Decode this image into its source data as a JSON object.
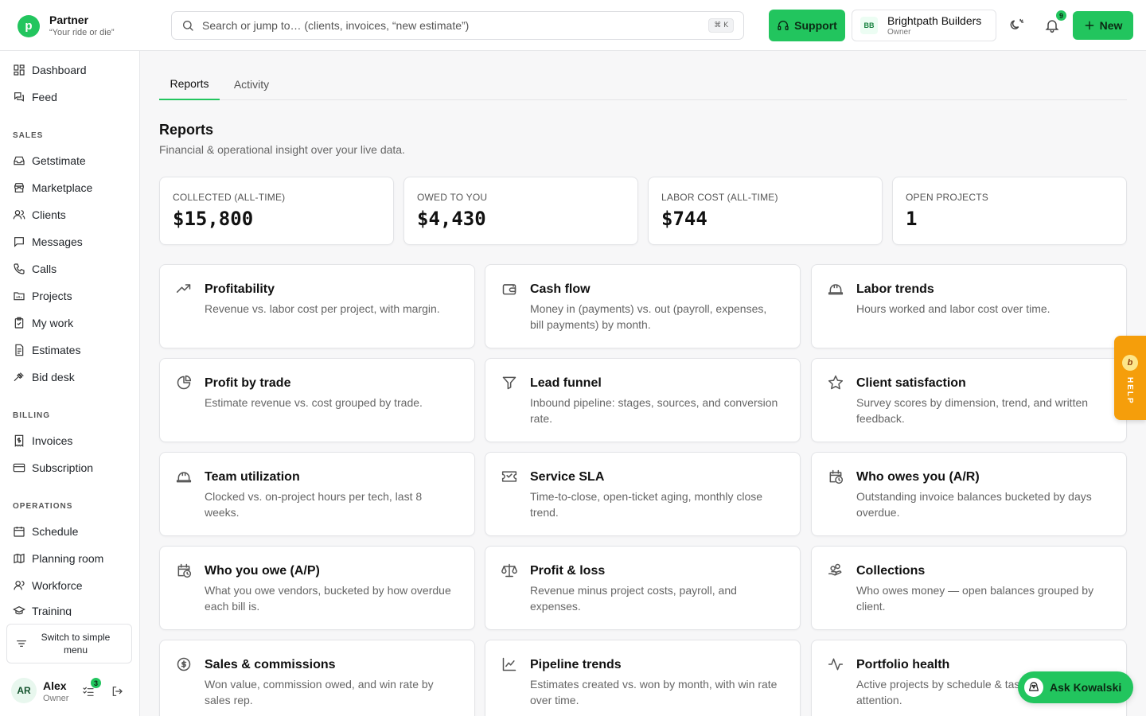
{
  "header": {
    "brand_initial": "p",
    "brand_name": "Partner",
    "brand_tagline": "“Your ride or die”",
    "search_placeholder": "Search or jump to… (clients, invoices, “new estimate”)",
    "search_shortcut": "⌘ K",
    "support_label": "Support",
    "org_initials": "BB",
    "org_name": "Brightpath Builders",
    "org_role": "Owner",
    "notifications_count": "9",
    "new_label": "New"
  },
  "sidebar": {
    "top_items": [
      {
        "label": "Dashboard",
        "icon": "dashboard-icon"
      },
      {
        "label": "Feed",
        "icon": "feed-icon"
      }
    ],
    "sections": [
      {
        "title": "SALES",
        "items": [
          "Getstimate",
          "Marketplace",
          "Clients",
          "Messages",
          "Calls",
          "Projects",
          "My work",
          "Estimates",
          "Bid desk"
        ]
      },
      {
        "title": "BILLING",
        "items": [
          "Invoices",
          "Subscription"
        ]
      },
      {
        "title": "OPERATIONS",
        "items": [
          "Schedule",
          "Planning room",
          "Workforce",
          "Training"
        ]
      }
    ],
    "switch_label": "Switch to simple menu",
    "user_initials": "AR",
    "user_name": "Alex",
    "user_role": "Owner",
    "tasks_count": "3"
  },
  "main": {
    "tabs": [
      "Reports",
      "Activity"
    ],
    "active_tab": "Reports",
    "title": "Reports",
    "subtitle": "Financial & operational insight over your live data.",
    "stats": [
      {
        "label": "COLLECTED (ALL-TIME)",
        "value": "$15,800"
      },
      {
        "label": "OWED TO YOU",
        "value": "$4,430"
      },
      {
        "label": "LABOR COST (ALL-TIME)",
        "value": "$744"
      },
      {
        "label": "OPEN PROJECTS",
        "value": "1"
      }
    ],
    "reports": [
      {
        "title": "Profitability",
        "desc": "Revenue vs. labor cost per project, with margin.",
        "icon": "trending-up-icon"
      },
      {
        "title": "Cash flow",
        "desc": "Money in (payments) vs. out (payroll, expenses, bill payments) by month.",
        "icon": "wallet-icon"
      },
      {
        "title": "Labor trends",
        "desc": "Hours worked and labor cost over time.",
        "icon": "hard-hat-icon"
      },
      {
        "title": "Profit by trade",
        "desc": "Estimate revenue vs. cost grouped by trade.",
        "icon": "pie-chart-icon"
      },
      {
        "title": "Lead funnel",
        "desc": "Inbound pipeline: stages, sources, and conversion rate.",
        "icon": "funnel-icon"
      },
      {
        "title": "Client satisfaction",
        "desc": "Survey scores by dimension, trend, and written feedback.",
        "icon": "star-icon"
      },
      {
        "title": "Team utilization",
        "desc": "Clocked vs. on-project hours per tech, last 8 weeks.",
        "icon": "hard-hat-icon"
      },
      {
        "title": "Service SLA",
        "desc": "Time-to-close, open-ticket aging, monthly close trend.",
        "icon": "ticket-icon"
      },
      {
        "title": "Who owes you (A/R)",
        "desc": "Outstanding invoice balances bucketed by days overdue.",
        "icon": "calendar-clock-icon"
      },
      {
        "title": "Who you owe (A/P)",
        "desc": "What you owe vendors, bucketed by how overdue each bill is.",
        "icon": "calendar-clock-icon"
      },
      {
        "title": "Profit & loss",
        "desc": "Revenue minus project costs, payroll, and expenses.",
        "icon": "scale-icon"
      },
      {
        "title": "Collections",
        "desc": "Who owes money — open balances grouped by client.",
        "icon": "hand-coins-icon"
      },
      {
        "title": "Sales & commissions",
        "desc": "Won value, commission owed, and win rate by sales rep.",
        "icon": "dollar-circle-icon"
      },
      {
        "title": "Pipeline trends",
        "desc": "Estimates created vs. won by month, with win rate over time.",
        "icon": "line-chart-icon"
      },
      {
        "title": "Portfolio health",
        "desc": "Active projects by schedule & task — what needs attention.",
        "icon": "activity-icon"
      }
    ]
  },
  "help_tab": {
    "glyph": "b",
    "label": "HELP"
  },
  "assistant": {
    "label": "Ask Kowalski"
  },
  "colors": {
    "accent": "#22c55e",
    "help": "#f59e0b"
  }
}
